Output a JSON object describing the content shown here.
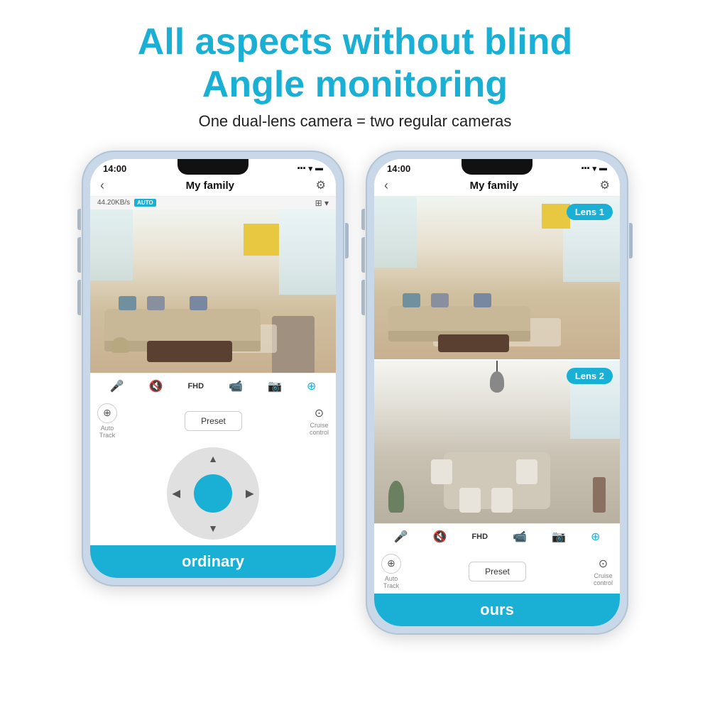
{
  "header": {
    "title_line1": "All aspects without blind",
    "title_line2": "Angle monitoring",
    "subtitle": "One dual-lens camera = two regular cameras"
  },
  "phone_left": {
    "label": "ordinary",
    "time": "14:00",
    "status": "▪▪▪ ▾ ▬",
    "nav_title": "My family",
    "speed": "44.20KB/s",
    "auto_badge": "AUTO",
    "controls": [
      "mic",
      "mute",
      "FHD",
      "record",
      "snapshot",
      "dots"
    ],
    "auto_track_label": "Auto\nTrack",
    "preset_label": "Preset",
    "cruise_label": "Cruise\ncontrol"
  },
  "phone_right": {
    "label": "ours",
    "time": "14:00",
    "status": "▪▪▪ ▾ ▬",
    "nav_title": "My family",
    "lens1_badge": "Lens 1",
    "lens2_badge": "Lens 2",
    "controls": [
      "mic",
      "mute",
      "FHD",
      "record",
      "snapshot",
      "dots"
    ],
    "auto_track_label": "Auto\nTrack",
    "preset_label": "Preset",
    "cruise_label": "Cruise\ncontrol"
  },
  "icons": {
    "back": "‹",
    "settings": "⊙",
    "mic": "🎤",
    "mute": "🔇",
    "record": "📹",
    "snapshot": "📷",
    "dots": "⊕",
    "auto_track": "⊕",
    "cruise": "⊙",
    "up_arrow": "▲",
    "down_arrow": "▼",
    "left_arrow": "◀",
    "right_arrow": "▶"
  },
  "colors": {
    "accent": "#1ab0d5",
    "label_bg": "#1ab0d5",
    "text_dark": "#111111",
    "text_gray": "#888888",
    "phone_frame": "#c8d8e8"
  }
}
